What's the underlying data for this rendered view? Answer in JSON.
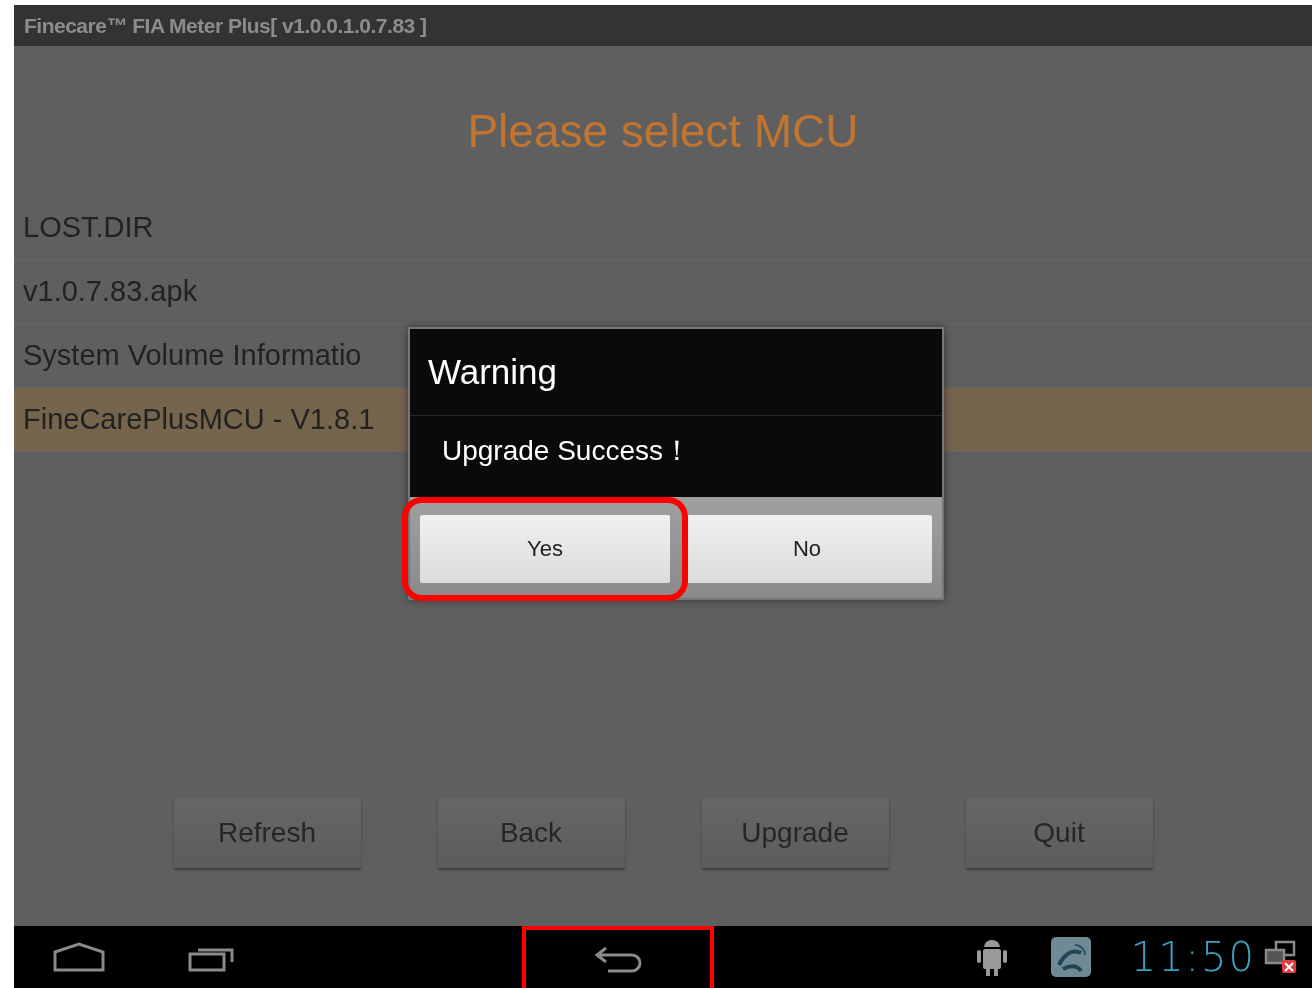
{
  "window": {
    "title": "Finecare™ FIA Meter Plus[ v1.0.0.1.0.7.83 ]"
  },
  "heading": "Please select MCU",
  "files": [
    {
      "name": "LOST.DIR",
      "selected": false
    },
    {
      "name": "v1.0.7.83.apk",
      "selected": false
    },
    {
      "name": "System Volume Informatio",
      "selected": false
    },
    {
      "name": "FineCarePlusMCU - V1.8.1",
      "selected": true
    }
  ],
  "actions": [
    "Refresh",
    "Back",
    "Upgrade",
    "Quit"
  ],
  "dialog": {
    "title": "Warning",
    "message": "Upgrade Success！",
    "buttons": [
      {
        "label": "Yes",
        "highlighted": true
      },
      {
        "label": "No",
        "highlighted": false
      }
    ]
  },
  "nav": [
    {
      "kind": "home",
      "highlighted": false
    },
    {
      "kind": "recent",
      "highlighted": false
    },
    {
      "kind": "back",
      "highlighted": true
    }
  ],
  "status": {
    "time": "11:50"
  }
}
